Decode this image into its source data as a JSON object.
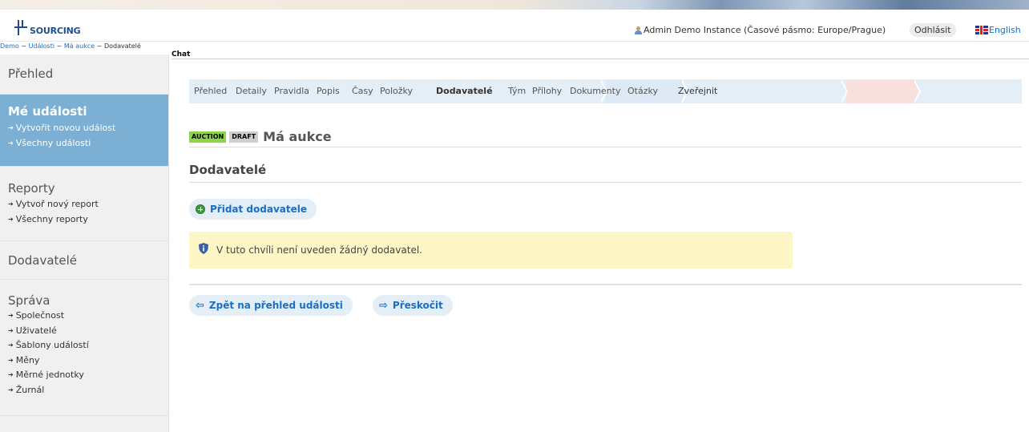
{
  "header": {
    "logo_text": "SOURCING",
    "user_info": "Admin Demo Instance (Časové pásmo: Europe/Prague)",
    "logout_label": "Odhlásit",
    "language_label": "English"
  },
  "breadcrumb": [
    "Demo",
    "Události",
    "Má aukce",
    "Dodavatelé"
  ],
  "breadcrumb_sep": " ~ ",
  "chat_label": "Chat",
  "sidebar": {
    "overview": "Přehled",
    "my_events": {
      "title": "Mé události",
      "items": [
        "Vytvořit novou událost",
        "Všechny události"
      ]
    },
    "reports": {
      "title": "Reporty",
      "items": [
        "Vytvoř nový report",
        "Všechny reporty"
      ]
    },
    "suppliers": "Dodavatelé",
    "admin": {
      "title": "Správa",
      "items": [
        "Společnost",
        "Uživatelé",
        "Šablony událostí",
        "Měny",
        "Měrné jednotky",
        "Žurnál"
      ]
    }
  },
  "steps": [
    "Přehled",
    "Detaily",
    "Pravidla",
    "Popis",
    "Časy",
    "Položky",
    "Dodavatelé",
    "Tým",
    "Přílohy",
    "Dokumenty",
    "Otázky",
    "Zveřejnit"
  ],
  "active_step": "Dodavatelé",
  "event": {
    "badge_type": "AUCTION",
    "badge_state": "DRAFT",
    "title": "Má aukce"
  },
  "section_title": "Dodavatelé",
  "add_supplier_label": "Přidat dodavatele",
  "notice_text": "V tuto chvíli není uveden žádný dodavatel.",
  "back_label": "Zpět na přehled události",
  "skip_label": "Přeskočit",
  "colors": {
    "accent": "#1b6fc2",
    "sidebar_active": "#7bafd4",
    "notice_bg": "#fdf6c6",
    "badge_auction": "#8fd34a"
  }
}
